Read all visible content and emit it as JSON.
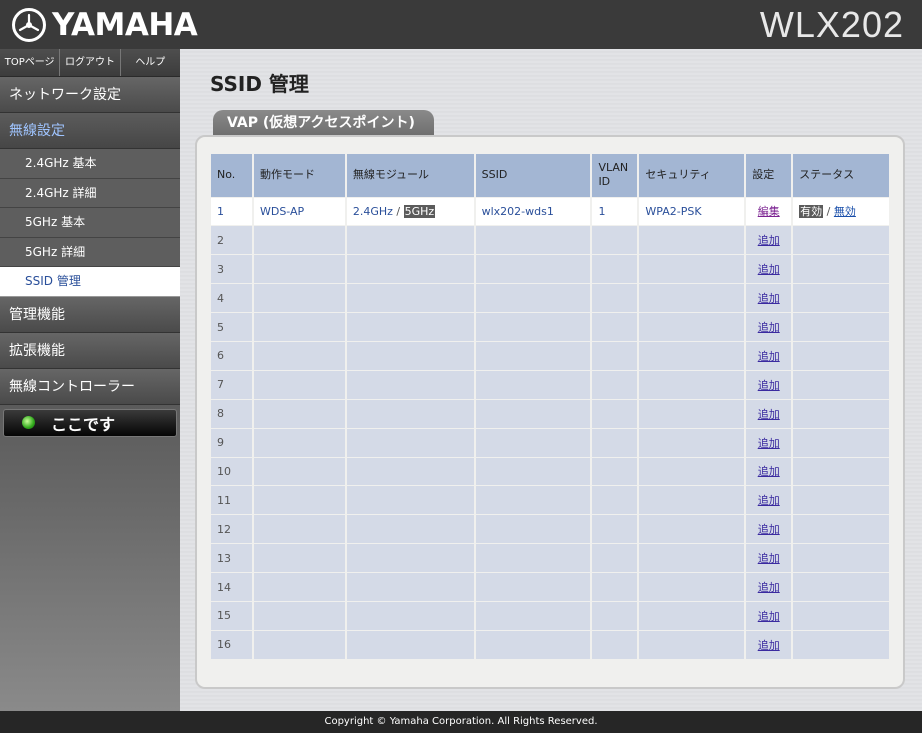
{
  "header": {
    "brand": "YAMAHA",
    "model": "WLX202"
  },
  "topnav": {
    "top_label": "TOPページ",
    "logout_label": "ログアウト",
    "help_label": "ヘルプ"
  },
  "sidebar": {
    "network": "ネットワーク設定",
    "wireless": "無線設定",
    "sub": {
      "g24_basic": "2.4GHz 基本",
      "g24_detail": "2.4GHz 詳細",
      "g5_basic": "5GHz 基本",
      "g5_detail": "5GHz 詳細",
      "ssid": "SSID 管理"
    },
    "management": "管理機能",
    "extension": "拡張機能",
    "controller": "無線コントローラー",
    "here_button": "ここです"
  },
  "main": {
    "title": "SSID 管理",
    "tab_label": "VAP (仮想アクセスポイント)",
    "table": {
      "headers": {
        "no": "No.",
        "mode": "動作モード",
        "module": "無線モジュール",
        "ssid": "SSID",
        "vlan": "VLAN ID",
        "security": "セキュリティ",
        "setting": "設定",
        "status": "ステータス"
      },
      "row1": {
        "no": "1",
        "mode": "WDS-AP",
        "module_a": "2.4GHz",
        "module_sep": "/",
        "module_b": "5GHz",
        "ssid": "wlx202-wds1",
        "vlan": "1",
        "security": "WPA2-PSK",
        "edit": "編集",
        "status_on": "有効",
        "status_sep": "/",
        "status_off": "無効"
      },
      "add_label": "追加",
      "empty_rows": [
        "2",
        "3",
        "4",
        "5",
        "6",
        "7",
        "8",
        "9",
        "10",
        "11",
        "12",
        "13",
        "14",
        "15",
        "16"
      ]
    }
  },
  "footer": {
    "copyright": "Copyright © Yamaha Corporation. All Rights Reserved."
  }
}
